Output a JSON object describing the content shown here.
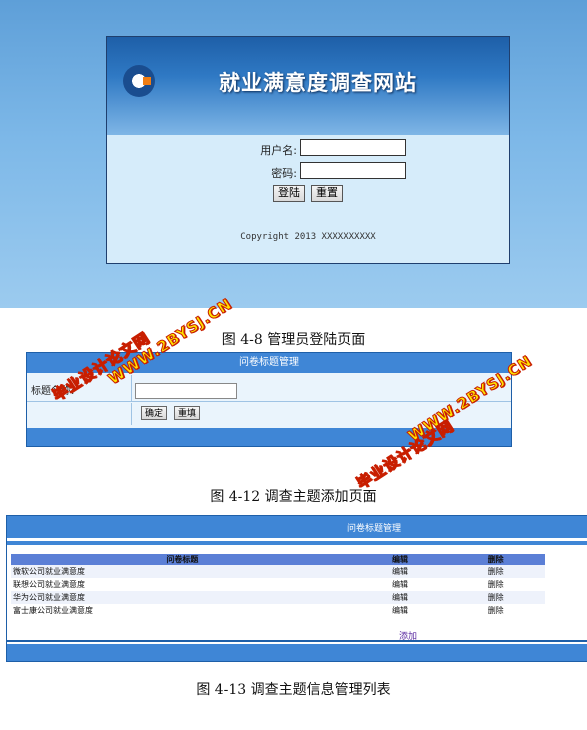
{
  "login": {
    "site_title": "就业满意度调查网站",
    "username_label": "用户名:",
    "password_label": "密码:",
    "login_button": "登陆",
    "reset_button": "重置",
    "copyright": "Copyright 2013 XXXXXXXXXX"
  },
  "captions": {
    "fig1": "图 4-8 管理员登陆页面",
    "fig2": "图 4-12 调查主题添加页面",
    "fig3": "图 4-13 调查主题信息管理列表"
  },
  "add_page": {
    "header": "问卷标题管理",
    "title_label": "标题名称:",
    "confirm_button": "确定",
    "refill_button": "重填"
  },
  "list_page": {
    "header": "问卷标题管理",
    "columns": [
      "问卷标题",
      "编辑",
      "删除"
    ],
    "rows": [
      {
        "title": "微软公司就业满意度",
        "edit": "编辑",
        "delete": "删除"
      },
      {
        "title": "联想公司就业满意度",
        "edit": "编辑",
        "delete": "删除"
      },
      {
        "title": "华为公司就业满意度",
        "edit": "编辑",
        "delete": "删除"
      },
      {
        "title": "富士康公司就业满意度",
        "edit": "编辑",
        "delete": "删除"
      }
    ],
    "add_link": "添加"
  },
  "watermarks": {
    "line1": "毕业设计论文网",
    "line2": "WWW.2BYSJ.CN"
  },
  "colors": {
    "header_blue": "#3f86d6",
    "watermark_fill": "#ffe400",
    "watermark_outline": "#c81e00"
  }
}
